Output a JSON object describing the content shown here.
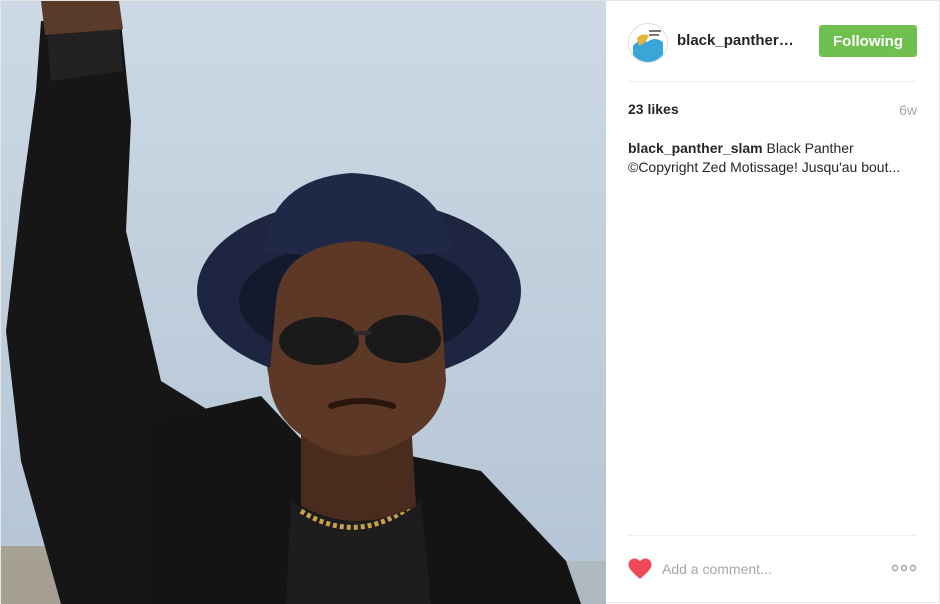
{
  "post": {
    "image_alt": "",
    "username_header": "black_panther_...",
    "follow_label": "Following",
    "likes": "23 likes",
    "age": "6w",
    "caption_user": "black_panther_slam",
    "caption_text_line1": "Black Panther",
    "caption_text_line2": "©Copyright Zed Motissage! Jusqu'au bout...",
    "comment_placeholder": "Add a comment...",
    "colors": {
      "follow": "#70c050",
      "heart": "#ed4956"
    }
  }
}
